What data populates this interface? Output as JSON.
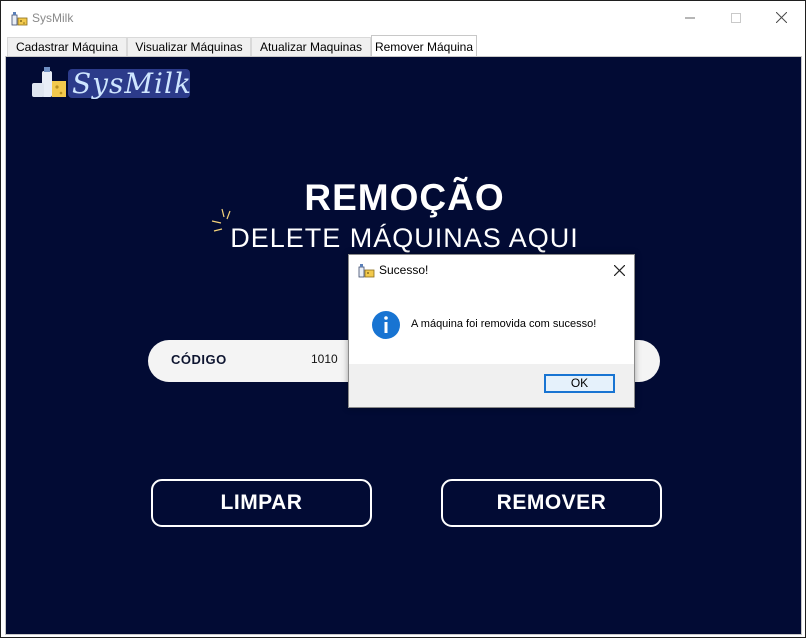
{
  "window": {
    "title": "SysMilk",
    "icon": "milk-cheese-app-icon"
  },
  "tabs": [
    {
      "label": "Cadastrar Máquina",
      "active": false
    },
    {
      "label": "Visualizar Máquinas",
      "active": false
    },
    {
      "label": "Atualizar Maquinas",
      "active": false
    },
    {
      "label": "Remover Máquina",
      "active": true
    }
  ],
  "main": {
    "logo_text": "SysMilk",
    "title": "REMOÇÃO",
    "subtitle": "DELETE MÁQUINAS AQUI",
    "code_label": "CÓDIGO",
    "code_value": "1010",
    "clear_button": "LIMPAR",
    "remove_button": "REMOVER"
  },
  "dialog": {
    "title": "Sucesso!",
    "message": "A máquina foi removida com sucesso!",
    "ok_label": "OK",
    "icon": "info-icon"
  },
  "colors": {
    "background": "#020b34",
    "accent": "#1874d2",
    "text": "#ffffff"
  }
}
